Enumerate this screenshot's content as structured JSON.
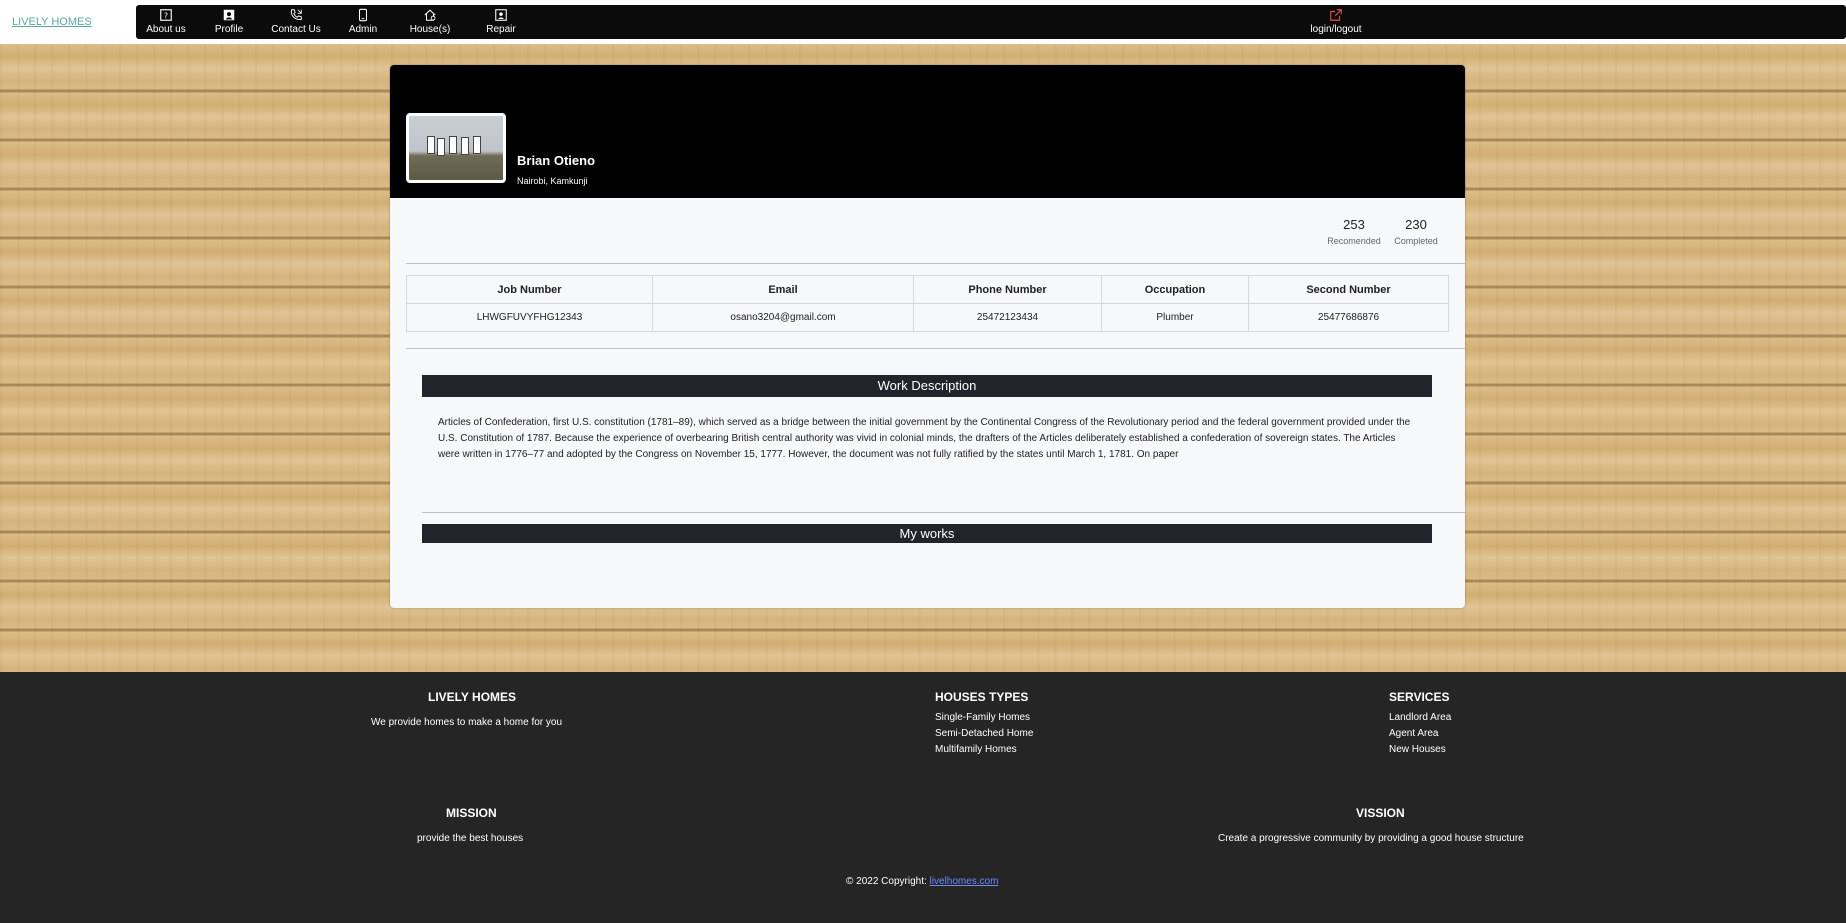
{
  "brand": "LIVELY HOMES",
  "nav": [
    {
      "label": "About us",
      "icon": "question-icon"
    },
    {
      "label": "Profile",
      "icon": "person-icon"
    },
    {
      "label": "Contact Us",
      "icon": "phone-icon"
    },
    {
      "label": "Admin",
      "icon": "phone-device-icon"
    },
    {
      "label": "House(s)",
      "icon": "house-icon"
    },
    {
      "label": "Repair",
      "icon": "person-badge-icon"
    }
  ],
  "login": {
    "label": "login/logout",
    "icon": "external-link-icon",
    "icon_color": "#e05050"
  },
  "profile": {
    "name": "Brian Otieno",
    "location": "Nairobi, Kamkunji",
    "stats": [
      {
        "value": "253",
        "caption": "Recomended"
      },
      {
        "value": "230",
        "caption": "Completed"
      }
    ]
  },
  "table": {
    "headers": [
      "Job Number",
      "Email",
      "Phone Number",
      "Occupation",
      "Second Number"
    ],
    "rows": [
      [
        "LHWGFUVYFHG12343",
        "osano3204@gmail.com",
        "25472123434",
        "Plumber",
        "25477686876"
      ]
    ]
  },
  "work": {
    "title": "Work Description",
    "text": "Articles of Confederation, first U.S. constitution (1781–89), which served as a bridge between the initial government by the Continental Congress of the Revolutionary period and the federal government provided under the U.S. Constitution of 1787. Because the experience of overbearing British central authority was vivid in colonial minds, the drafters of the Articles deliberately established a confederation of sovereign states. The Articles were written in 1776–77 and adopted by the Congress on November 15, 1777. However, the document was not fully ratified by the states until March 1, 1781. On paper"
  },
  "my_works": {
    "title": "My works"
  },
  "footer": {
    "brand": {
      "title": "LIVELY HOMES",
      "text": "We provide homes to make a home for you"
    },
    "house_types": {
      "title": "HOUSES TYPES",
      "items": [
        "Single-Family Homes",
        "Semi-Detached Home",
        "Multifamily Homes"
      ]
    },
    "services": {
      "title": "SERVICES",
      "items": [
        "Landlord Area",
        "Agent Area",
        "New Houses"
      ]
    },
    "mission": {
      "title": "MISSION",
      "text": "provide the best houses"
    },
    "vission": {
      "title": "VISSION",
      "text": "Create a progressive community by providing a good house structure"
    },
    "copyright": "© 2022 Copyright: ",
    "copyright_link": "livelhomes.com"
  },
  "colors": {
    "nav_bg": "#0b0b0b",
    "section_bar": "#212529",
    "footer_bg": "#252525",
    "brand_link": "#5aa7a0"
  }
}
